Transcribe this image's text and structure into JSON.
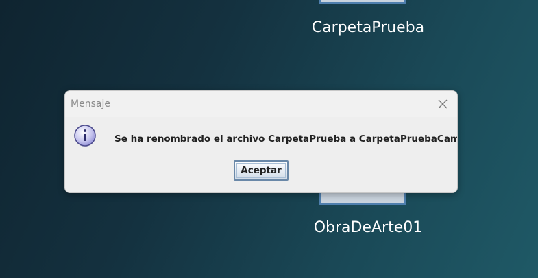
{
  "desktop": {
    "items": [
      {
        "label": "CarpetaPrueba"
      },
      {
        "label": "ObraDeArte01"
      }
    ]
  },
  "dialog": {
    "title": "Mensaje",
    "icon": "info-icon",
    "message": "Se ha renombrado el archivo CarpetaPrueba a CarpetaPruebaCambio",
    "ok_label": "Aceptar",
    "close_icon": "close-icon"
  },
  "colors": {
    "desktop_dark": "#0f2430",
    "desktop_light": "#1f5966",
    "folder_border": "#4f7fae",
    "dialog_bg": "#eeeeee"
  }
}
